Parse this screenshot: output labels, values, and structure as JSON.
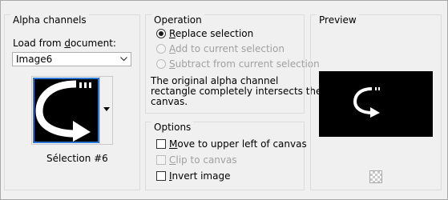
{
  "alpha": {
    "title": "Alpha channels",
    "load_label_pre": "Load from ",
    "load_label_u": "d",
    "load_label_post": "ocument:",
    "document": "Image6",
    "selection_name": "Sélection #6"
  },
  "operation": {
    "title": "Operation",
    "options": [
      {
        "u": "R",
        "rest": "eplace selection",
        "checked": true,
        "enabled": true
      },
      {
        "u": "A",
        "rest": "dd to current selection",
        "checked": false,
        "enabled": false
      },
      {
        "u": "S",
        "rest": "ubtract from current selection",
        "checked": false,
        "enabled": false
      }
    ],
    "message": [
      "The original alpha channel",
      "rectangle completely intersects the",
      "canvas."
    ]
  },
  "options": {
    "title": "Options",
    "items": [
      {
        "u": "M",
        "rest": "ove to upper left of canvas",
        "checked": false,
        "enabled": true
      },
      {
        "u": "C",
        "rest": "lip to canvas",
        "checked": false,
        "enabled": false
      },
      {
        "u": "I",
        "rest": "nvert image",
        "checked": false,
        "enabled": true
      }
    ]
  },
  "preview": {
    "title": "Preview"
  },
  "colors": {
    "accent": "#2a7ad3",
    "disabled_text": "#a0a0a0"
  }
}
